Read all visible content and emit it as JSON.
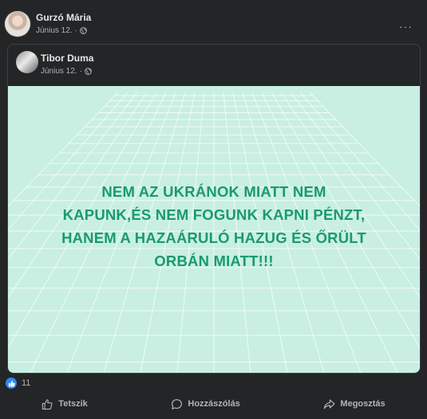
{
  "post": {
    "author": "Gurzó Mária",
    "date": "Június 12.",
    "separator": "·",
    "privacy_icon": "globe-icon",
    "menu_icon": "more-options-icon",
    "menu_label": "···"
  },
  "shared_post": {
    "author": "Tibor Duma",
    "date": "Június 12.",
    "separator": "·",
    "privacy_icon": "globe-icon",
    "image_text": {
      "line1": "NEM AZ UKRÁNOK MIATT NEM",
      "line2": "KAPUNK,ÉS NEM FOGUNK KAPNI PÉNZT,",
      "line3": "HANEM A HAZAÁRULÓ HAZUG ÉS ŐRÜLT",
      "line4": "ORBÁN MIATT!!!"
    },
    "colors": {
      "background": "#c8efe2",
      "text": "#1a9a6d"
    }
  },
  "reactions": {
    "icon": "like-icon",
    "count": "11"
  },
  "actions": {
    "like": "Tetszik",
    "comment": "Hozzászólás",
    "share": "Megosztás"
  },
  "colors": {
    "accent": "#2d88ff",
    "surface": "#242526",
    "page": "#18191a"
  }
}
